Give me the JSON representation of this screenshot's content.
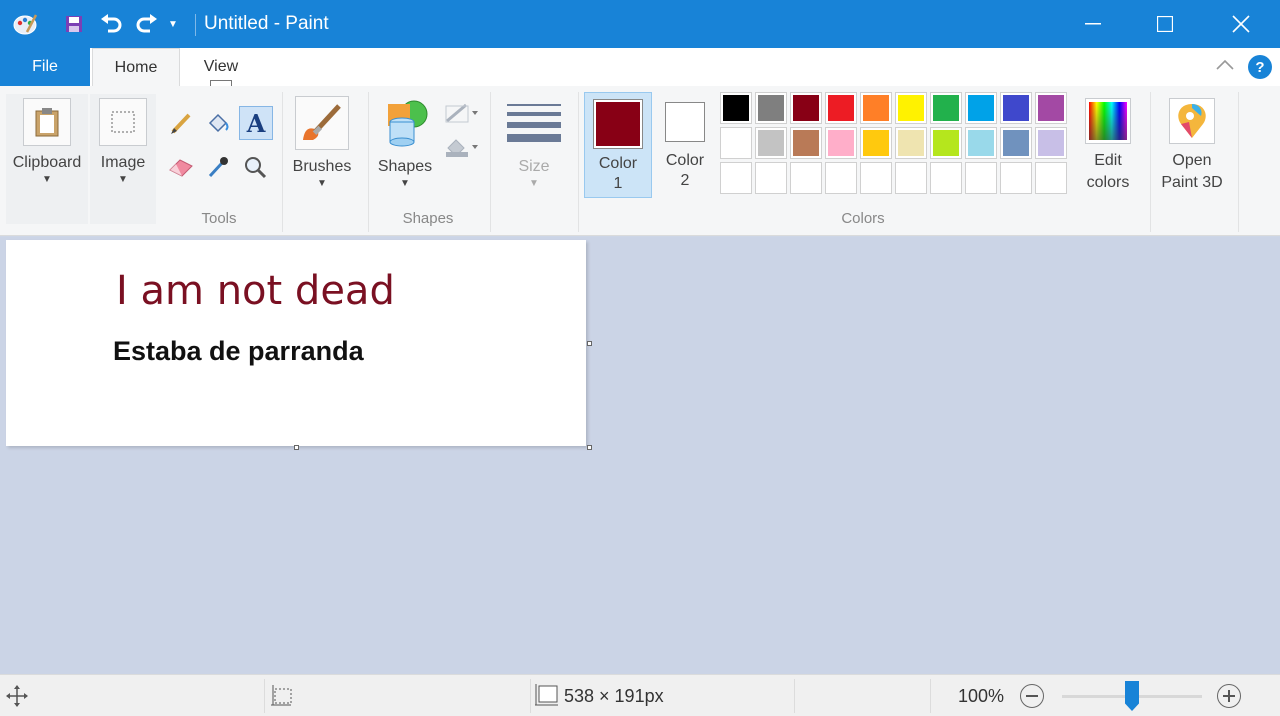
{
  "window": {
    "title": "Untitled - Paint",
    "accent_color": "#1883d7"
  },
  "tabs": {
    "file": "File",
    "home": "Home",
    "view": "View",
    "keytip": "V"
  },
  "ribbon": {
    "clipboard": "Clipboard",
    "image": "Image",
    "tools_group": "Tools",
    "brushes": "Brushes",
    "shapes": "Shapes",
    "shapes_group": "Shapes",
    "size": "Size",
    "color1_line1": "Color",
    "color1_line2": "1",
    "color2_line1": "Color",
    "color2_line2": "2",
    "colors_group": "Colors",
    "edit_colors_line1": "Edit",
    "edit_colors_line2": "colors",
    "open_paint3d_line1": "Open",
    "open_paint3d_line2": "Paint 3D",
    "color1_value": "#880015",
    "color2_value": "#ffffff",
    "palette_row1": [
      "#000000",
      "#7f7f7f",
      "#880015",
      "#ed1c24",
      "#ff7f27",
      "#fff200",
      "#22b14c",
      "#00a2e8",
      "#3f48cc",
      "#a349a4"
    ],
    "palette_row2": [
      "#ffffff",
      "#c3c3c3",
      "#b97a57",
      "#ffaec9",
      "#ffc90e",
      "#efe4b0",
      "#b5e61d",
      "#99d9ea",
      "#7092be",
      "#c8bfe7"
    ]
  },
  "canvas": {
    "text_line1": "I am not dead",
    "text_line2": "Estaba de parranda"
  },
  "status": {
    "size": "538 × 191px",
    "zoom": "100%",
    "zoom_level": 0.5
  }
}
